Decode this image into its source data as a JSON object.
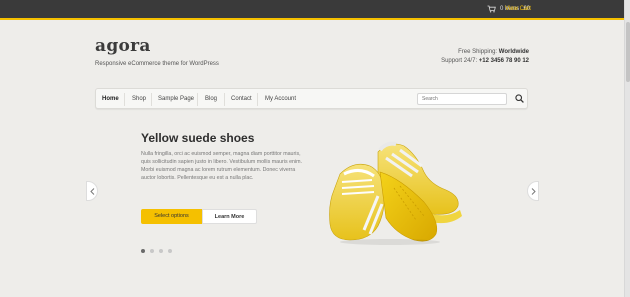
{
  "topbar": {
    "cart_icon": "cart-icon",
    "cart_count": "0 items",
    "cart_total": "£0",
    "view_cart": "View Cart",
    "accent": "#f5c000"
  },
  "header": {
    "logo": "agora",
    "tagline": "Responsive eCommerce theme for WordPress",
    "shipping_label": "Free Shipping: ",
    "shipping_value": "Worldwide",
    "support_label": "Support 24/7: ",
    "support_value": "+12 3456 78 90 12"
  },
  "nav": {
    "items": [
      {
        "label": "Home"
      },
      {
        "label": "Shop"
      },
      {
        "label": "Sample Page"
      },
      {
        "label": "Blog"
      },
      {
        "label": "Contact"
      },
      {
        "label": "My Account"
      }
    ],
    "search_placeholder": "Search"
  },
  "slide": {
    "title": "Yellow suede shoes",
    "text": "Nulla fringilla, orci ac euismod semper, magna diam porttitor mauris, quis sollicitudin sapien justo in libero. Vestibulum mollis mauris enim. Morbi euismod magna ac lorem rutrum elementum. Donec viverra auctor lobortis. Pellentesque eu est a nulla plac.",
    "primary_button": "Select options",
    "secondary_button": "Learn More",
    "dots": [
      true,
      false,
      false,
      false
    ],
    "image_icon": "yellow-sneakers-image"
  }
}
